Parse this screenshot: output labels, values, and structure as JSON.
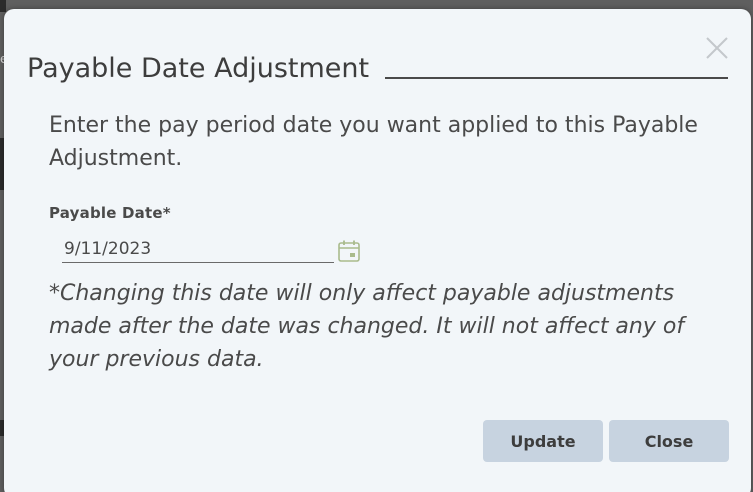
{
  "backdrop": {
    "edge_text": "e"
  },
  "dialog": {
    "title": "Payable Date Adjustment",
    "intro": "Enter the pay period date you want applied to this Payable Adjustment.",
    "field": {
      "label": "Payable Date*",
      "value": "9/11/2023"
    },
    "disclaimer": "*Changing this date will only affect payable adjustments made after the date was changed. It will not affect any of your previous data.",
    "buttons": {
      "update_label": "Update",
      "close_label": "Close"
    }
  },
  "icons": {
    "close": "close-icon",
    "calendar": "calendar-icon"
  },
  "colors": {
    "dialog_background": "#f2f6f9",
    "button_background": "#c7d3e0",
    "calendar_icon": "#a9bb8c",
    "text": "#4a4a4a"
  }
}
